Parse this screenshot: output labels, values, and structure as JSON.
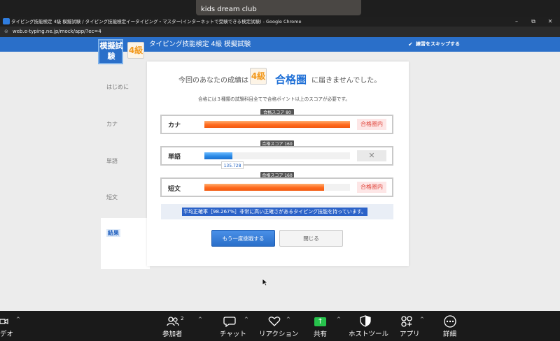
{
  "video": {
    "participant_name": "kids dream club"
  },
  "browser": {
    "window_title": "タイピング技能検定 4級 模擬試験 / タイピング技能検定イータイピング・マスター(インターネットで受験できる検定試験) - Google Chrome",
    "url": "web.e-typing.ne.jp/mock/app/?ec=4",
    "controls": {
      "minimize": "–",
      "maximize": "⧉",
      "close": "✕"
    }
  },
  "header": {
    "logo_text": "模擬試験",
    "logo_grade": "4級",
    "title": "タイピング技能検定 4級 模擬試験",
    "skip_label": "練習をスキップする",
    "skip_checked_mark": "✔"
  },
  "sidebar": {
    "items": [
      {
        "label": "はじめに"
      },
      {
        "label": "カナ"
      },
      {
        "label": "単語"
      },
      {
        "label": "短文"
      },
      {
        "label": "結果"
      }
    ]
  },
  "result": {
    "prefix": "今回のあなたの成績は",
    "grade_badge": "4級",
    "main": "合格圏",
    "suffix": "に届きませんでした。",
    "note": "合格には３種類の試験科目全てで合格ポイント以上のスコアが必要です。",
    "rows": [
      {
        "label": "カナ",
        "target_label": "合格スコア 80",
        "score_fraction": 1.0,
        "target_fraction": 0.5,
        "status": "合格圏内",
        "passed": true,
        "score_text": ""
      },
      {
        "label": "単語",
        "target_label": "合格スコア 160",
        "score_fraction": 0.19,
        "target_fraction": 0.5,
        "status": "✕",
        "passed": false,
        "score_text": "135.728"
      },
      {
        "label": "短文",
        "target_label": "合格スコア 160",
        "score_fraction": 0.82,
        "target_fraction": 0.5,
        "status": "合格圏内",
        "passed": true,
        "score_text": ""
      }
    ],
    "message": "平均正確率［98.267%］非常に高い正確さがあるタイピング技能を持っています。",
    "buttons": {
      "retry": "もう一度挑戦する",
      "close": "閉じる"
    }
  },
  "toolbar": {
    "video_label": "デオ",
    "participants_label": "参加者",
    "participants_count": "2",
    "chat_label": "チャット",
    "reactions_label": "リアクション",
    "share_label": "共有",
    "host_tools_label": "ホストツール",
    "apps_label": "アプリ",
    "more_label": "詳細",
    "caret": "^"
  },
  "colors": {
    "accent": "#2a6fc9",
    "pass": "#e0463c",
    "bar_orange": "#ff6a1e",
    "bar_blue": "#2a8ae6",
    "grade_orange": "#f29a1f"
  }
}
